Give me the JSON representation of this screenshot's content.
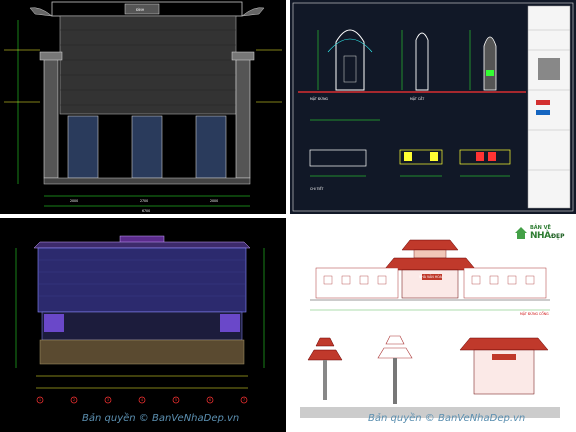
{
  "panels": {
    "p1": {
      "label_top": "ĐÌNH",
      "dims": [
        "2000",
        "2700",
        "2000",
        "6700"
      ]
    },
    "p2": {
      "labels": [
        "MẶT ĐỨNG",
        "MẶT CẮT",
        "CHI TIẾT"
      ]
    },
    "p3": {
      "axes": [
        "1",
        "2",
        "3",
        "4",
        "5",
        "6",
        "7"
      ]
    },
    "p4": {
      "sign": "NHÀ VĂN HÓA",
      "label": "MẶT ĐỨNG CỔNG"
    }
  },
  "watermark": {
    "left": "Bản quyền © BanVeNhaDep.vn",
    "right": "Bản quyền © BanVeNhaDep.vn"
  },
  "logo": {
    "line1": "BẢN VẼ",
    "line2": "NHÀ",
    "line3": "ĐẸP"
  },
  "colors": {
    "cad_black": "#000000",
    "cad_navy": "#111827",
    "roof_red": "#c0392b",
    "line_green": "#33ff33",
    "line_yellow": "#ffff33",
    "line_cyan": "#33ffff",
    "line_red": "#ff3333"
  }
}
